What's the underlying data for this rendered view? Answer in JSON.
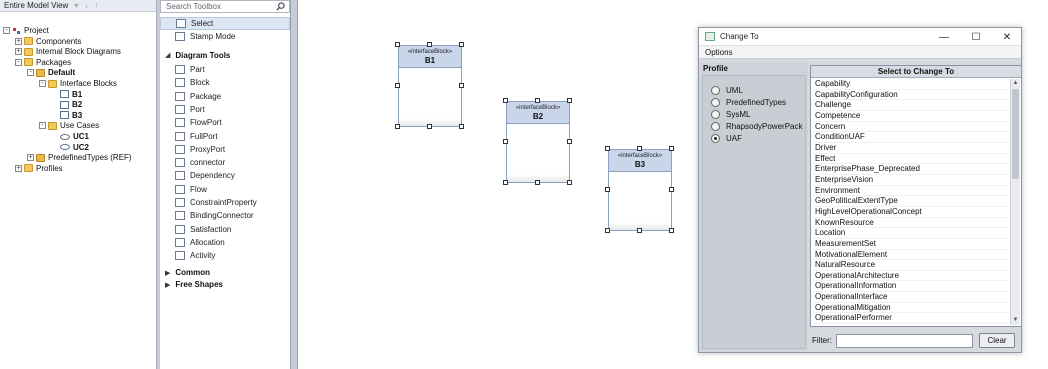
{
  "browser": {
    "view_label": "Entire Model View",
    "tree": [
      {
        "label": "Project",
        "icon": "project-icon",
        "bold": false
      },
      {
        "label": "Components",
        "icon": "folder-icon",
        "bold": false
      },
      {
        "label": "Internal Block Diagrams",
        "icon": "folder-icon",
        "bold": false
      },
      {
        "label": "Packages",
        "icon": "folder-icon",
        "bold": false
      },
      {
        "label": "Default",
        "icon": "package-icon",
        "bold": true
      },
      {
        "label": "Interface Blocks",
        "icon": "folder-icon",
        "bold": false
      },
      {
        "label": "B1",
        "icon": "block-icon",
        "bold": true
      },
      {
        "label": "B2",
        "icon": "block-icon",
        "bold": true
      },
      {
        "label": "B3",
        "icon": "block-icon",
        "bold": true
      },
      {
        "label": "Use Cases",
        "icon": "folder-icon",
        "bold": false
      },
      {
        "label": "UC1",
        "icon": "usecase-icon",
        "bold": true
      },
      {
        "label": "UC2",
        "icon": "usecase-icon",
        "bold": true
      },
      {
        "label": "PredefinedTypes (REF)",
        "icon": "package-icon",
        "bold": false
      },
      {
        "label": "Profiles",
        "icon": "folder-icon",
        "bold": false
      }
    ]
  },
  "toolbox": {
    "search_placeholder": "Search Toolbox",
    "top_items": [
      "Select",
      "Stamp Mode"
    ],
    "section_diagram_tools": "Diagram Tools",
    "tools": [
      "Part",
      "Block",
      "Package",
      "Port",
      "FlowPort",
      "FullPort",
      "ProxyPort",
      "connector",
      "Dependency",
      "Flow",
      "ConstraintProperty",
      "BindingConnector",
      "Satisfaction",
      "Allocation",
      "Activity"
    ],
    "section_common": "Common",
    "section_free_shapes": "Free Shapes"
  },
  "canvas": {
    "blocks": [
      {
        "stereotype": "«interfaceBlock»",
        "name": "B1"
      },
      {
        "stereotype": "«interfaceBlock»",
        "name": "B2"
      },
      {
        "stereotype": "«interfaceBlock»",
        "name": "B3"
      }
    ]
  },
  "dialog": {
    "title": "Change To",
    "menu": "Options",
    "profile_header": "Profile",
    "profiles": [
      {
        "label": "UML",
        "selected": false
      },
      {
        "label": "PredefinedTypes",
        "selected": false
      },
      {
        "label": "SysML",
        "selected": false
      },
      {
        "label": "RhapsodyPowerPack",
        "selected": false
      },
      {
        "label": "UAF",
        "selected": true
      }
    ],
    "select_header": "Select to Change To",
    "items": [
      "Capability",
      "CapabilityConfiguration",
      "Challenge",
      "Competence",
      "Concern",
      "ConditionUAF",
      "Driver",
      "Effect",
      "EnterprisePhase_Deprecated",
      "EnterpriseVision",
      "Environment",
      "GeoPoliticalExtentType",
      "HighLevelOperationalConcept",
      "KnownResource",
      "Location",
      "MeasurementSet",
      "MotivationalElement",
      "NaturalResource",
      "OperationalArchitecture",
      "OperationalInformation",
      "OperationalInterface",
      "OperationalMitigation",
      "OperationalPerformer"
    ],
    "filter_label": "Filter:",
    "filter_value": "",
    "clear_label": "Clear"
  }
}
